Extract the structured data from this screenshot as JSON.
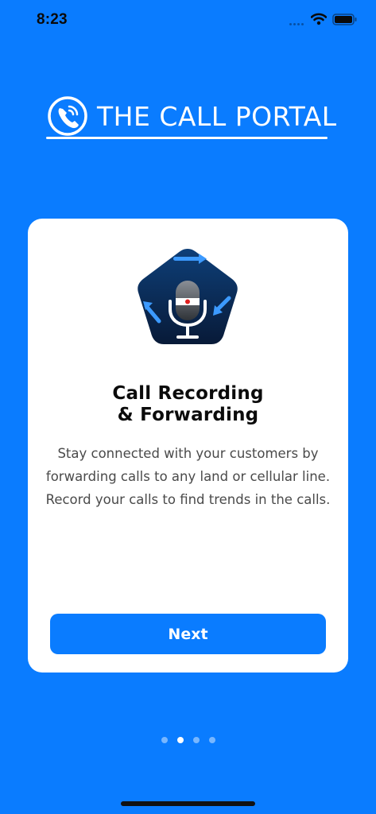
{
  "status_bar": {
    "time": "8:23"
  },
  "logo": {
    "text": "THE CALL PORTAL",
    "icon": "phone-circle-icon"
  },
  "card": {
    "title_line1": "Call Recording",
    "title_line2": "& Forwarding",
    "description_lines": [
      "Stay connected with your customers by",
      "forwarding calls to any land or cellular line.",
      "Record your calls to find trends in the calls."
    ],
    "icon": "microphone-recording-icon",
    "next_label": "Next"
  },
  "pagination": {
    "total": 4,
    "active_index": 1
  },
  "colors": {
    "background": "#0a7cff",
    "card": "#ffffff",
    "button": "#0a7cff",
    "icon_bg": "#0c2a55"
  }
}
